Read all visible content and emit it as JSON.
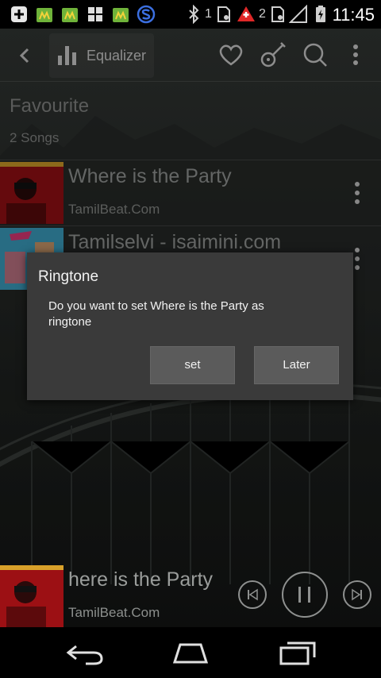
{
  "status_bar": {
    "time": "11:45",
    "sim1_label": "1",
    "sim2_label": "2",
    "icons": [
      "add-icon",
      "app-icon",
      "app-icon",
      "app-icon",
      "app-icon",
      "sync-icon",
      "bluetooth-icon",
      "signal-icon",
      "battery-icon"
    ]
  },
  "toolbar": {
    "equalizer_label": "Equalizer"
  },
  "playlist": {
    "title": "Favourite",
    "count_label": "2 Songs",
    "songs": [
      {
        "title": "Where is the Party",
        "artist": "TamilBeat.Com"
      },
      {
        "title": "Tamilselvi - isaimini.com",
        "artist": ""
      }
    ]
  },
  "dialog": {
    "title": "Ringtone",
    "message": "Do you want to set Where is the Party as ringtone",
    "primary_label": "set",
    "secondary_label": "Later"
  },
  "mini_player": {
    "title": "here is the Party",
    "artist": "TamilBeat.Com"
  },
  "colors": {
    "accent_red": "#c8171e",
    "text_muted": "#9a9d9b",
    "dialog_bg": "#3a3a3a",
    "button_bg": "#5b5b5b"
  }
}
